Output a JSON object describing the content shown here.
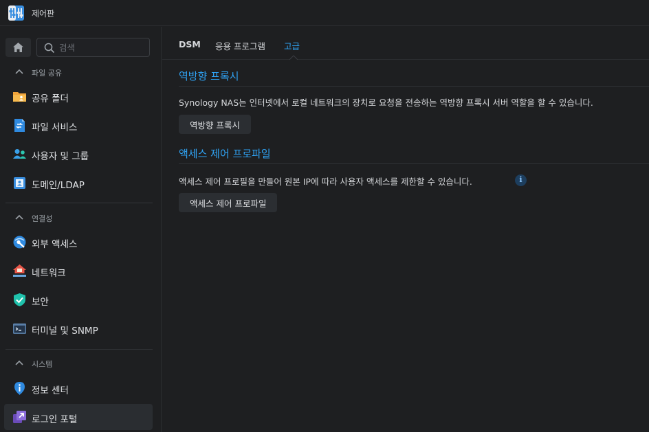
{
  "window": {
    "title": "제어판"
  },
  "sidebar": {
    "search_placeholder": "검색",
    "sections": [
      {
        "label": "파일 공유",
        "items": [
          {
            "label": "공유 폴더",
            "icon": "shared-folder-icon"
          },
          {
            "label": "파일 서비스",
            "icon": "file-services-icon"
          },
          {
            "label": "사용자 및 그룹",
            "icon": "users-groups-icon"
          },
          {
            "label": "도메인/LDAP",
            "icon": "domain-ldap-icon"
          }
        ]
      },
      {
        "label": "연결성",
        "items": [
          {
            "label": "외부 액세스",
            "icon": "external-access-icon"
          },
          {
            "label": "네트워크",
            "icon": "network-icon"
          },
          {
            "label": "보안",
            "icon": "security-shield-icon"
          },
          {
            "label": "터미널 및 SNMP",
            "icon": "terminal-icon"
          }
        ]
      },
      {
        "label": "시스템",
        "items": [
          {
            "label": "정보 센터",
            "icon": "info-center-icon"
          },
          {
            "label": "로그인 포털",
            "icon": "login-portal-icon",
            "active": true
          }
        ]
      }
    ]
  },
  "tabs": [
    {
      "label": "DSM"
    },
    {
      "label": "응용 프로그램"
    },
    {
      "label": "고급",
      "active": true
    }
  ],
  "sections": [
    {
      "title": "역방향 프록시",
      "description": "Synology NAS는 인터넷에서 로컬 네트워크의 장치로 요청을 전송하는 역방향 프록시 서버 역할을 할 수 있습니다.",
      "button": "역방향 프록시"
    },
    {
      "title": "액세스 제어 프로파일",
      "description": "액세스 제어 프로필을 만들어 원본 IP에 따라 사용자 액세스를 제한할 수 있습니다.",
      "button": "액세스 제어 프로파일"
    }
  ],
  "colors": {
    "accent": "#2fa3f5",
    "background": "#1e1f21"
  }
}
